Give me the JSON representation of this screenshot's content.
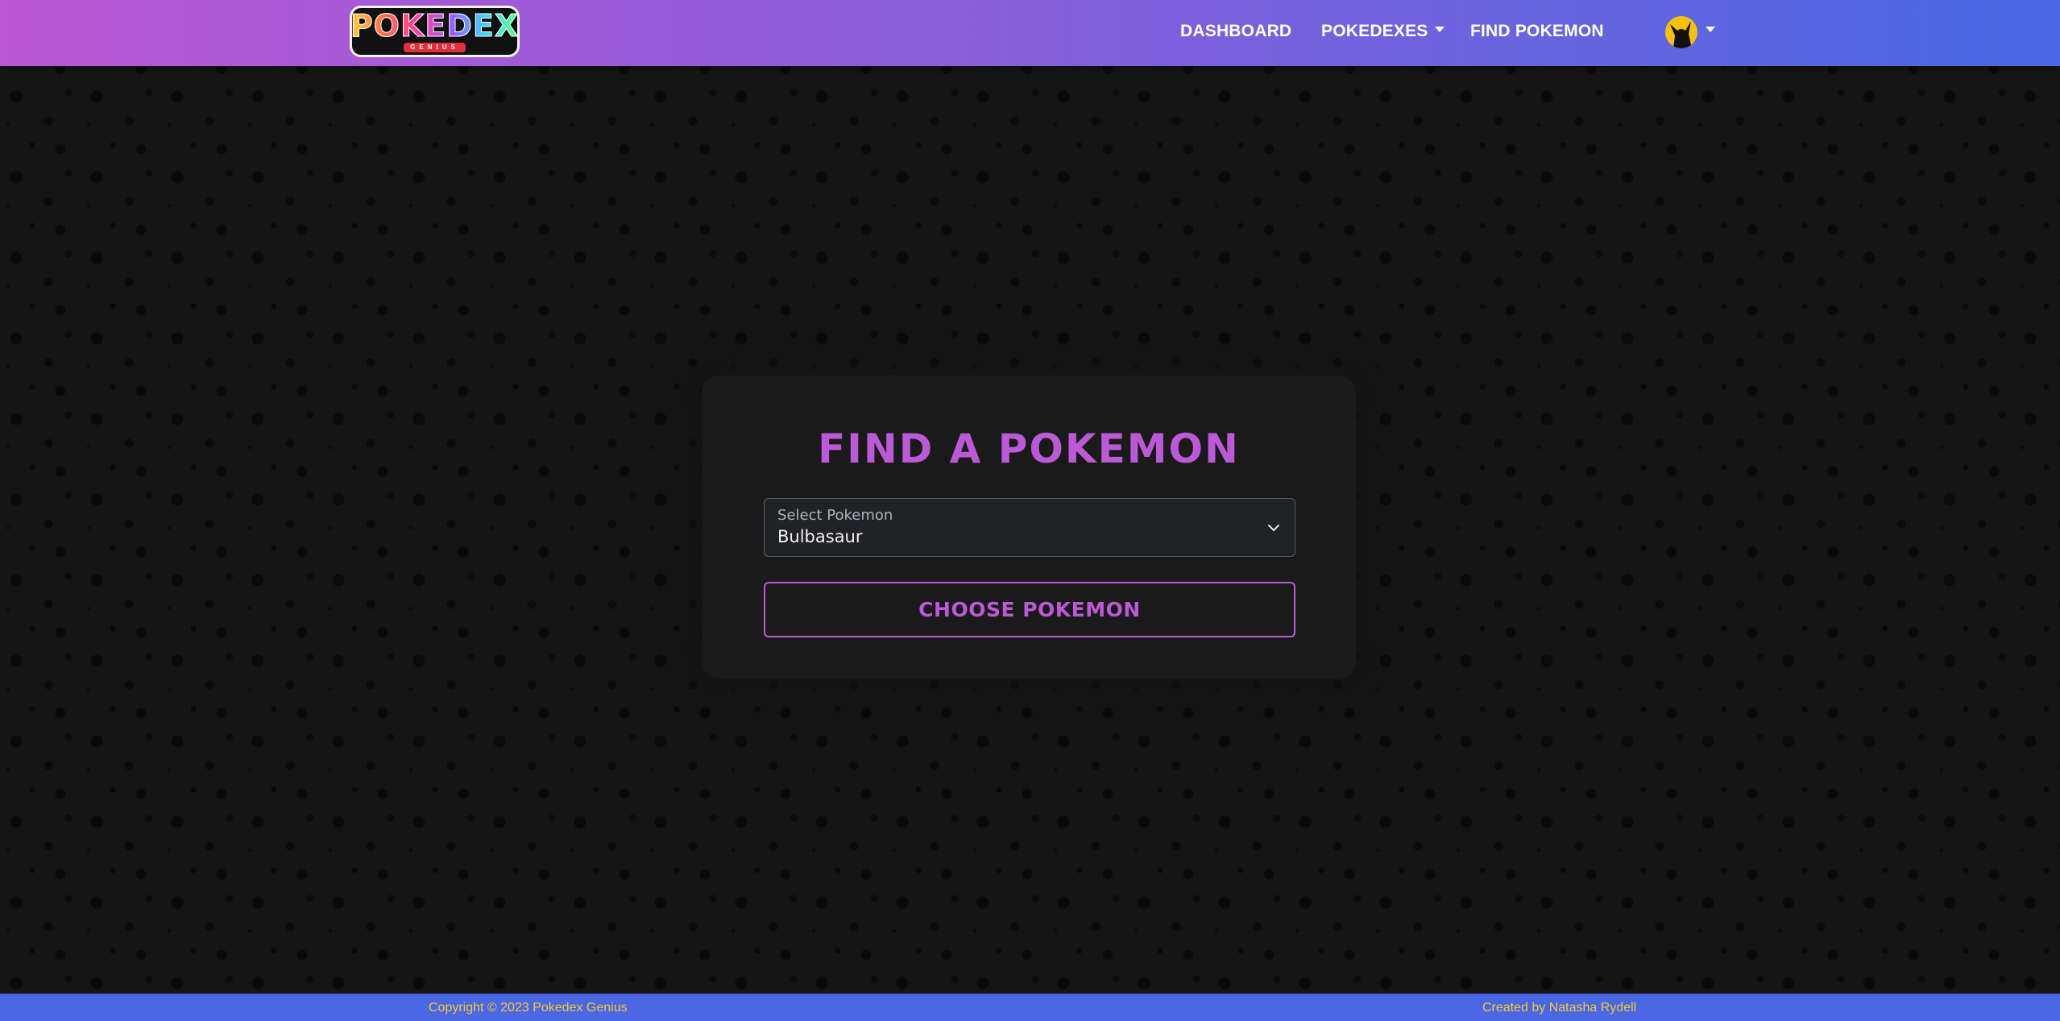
{
  "navbar": {
    "logo_text": "POKEDEX",
    "logo_subtext": "GENIUS",
    "links": {
      "dashboard": "DASHBOARD",
      "pokedexes": "POKEDEXES",
      "find_pokemon": "FIND POKEMON"
    },
    "avatar_icon": "pikachu-silhouette-icon"
  },
  "card": {
    "title": "FIND A POKEMON",
    "select": {
      "label": "Select Pokemon",
      "value": "Bulbasaur"
    },
    "button_label": "CHOOSE POKEMON"
  },
  "footer": {
    "copyright": "Copyright © 2023 Pokedex Genius",
    "credit": "Created by Natasha Rydell"
  },
  "colors": {
    "accent": "#bc59d6",
    "footer_bg": "#4a68e3",
    "footer_text": "#f6c63a",
    "background": "#151515"
  }
}
